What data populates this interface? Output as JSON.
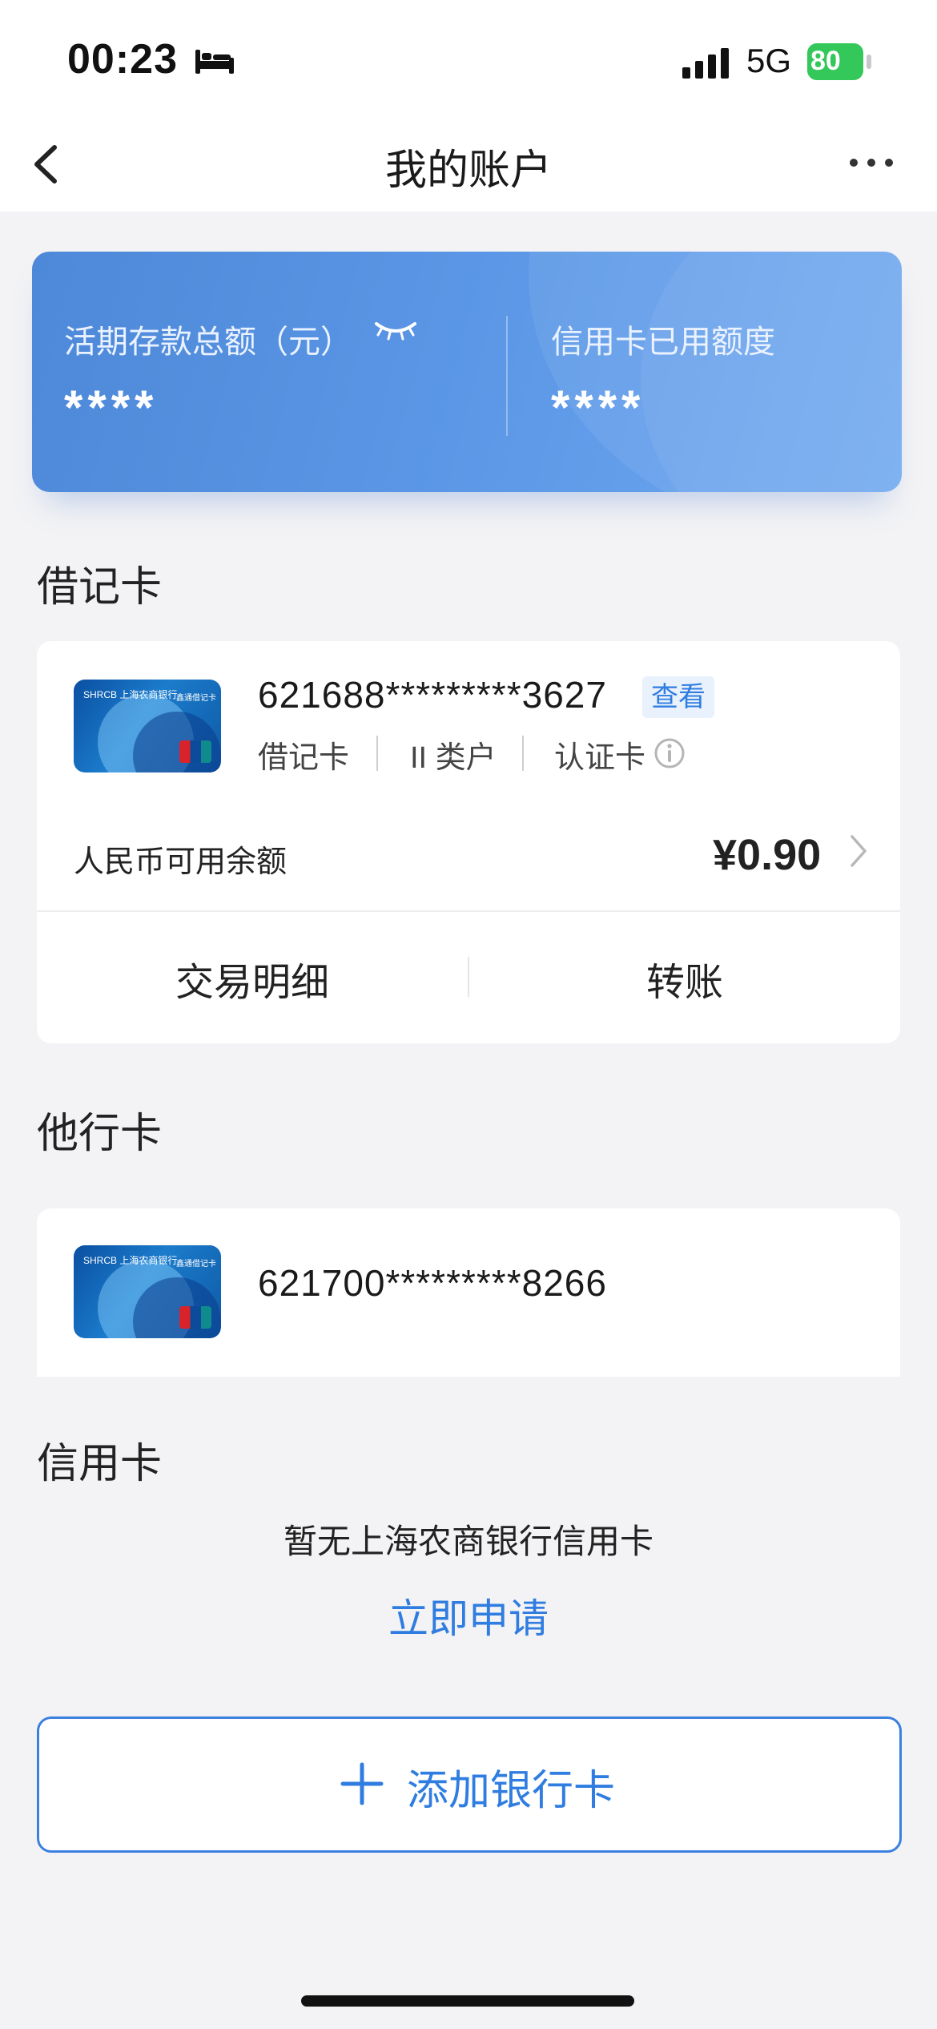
{
  "status_bar": {
    "time": "00:23",
    "network": "5G",
    "battery": "80"
  },
  "nav": {
    "title": "我的账户"
  },
  "summary": {
    "savings_label": "活期存款总额（元）",
    "savings_value": "****",
    "credit_label": "信用卡已用额度",
    "credit_value": "****"
  },
  "debit_section": {
    "title": "借记卡",
    "card": {
      "brand": "SHRCB 上海农商银行",
      "card_type_text": "鑫通借记卡",
      "number": "621688*********3627",
      "view_label": "查看",
      "tags": [
        "借记卡",
        "II 类户",
        "认证卡"
      ],
      "balance_label": "人民币可用余额",
      "balance_value": "¥0.90",
      "actions": [
        "交易明细",
        "转账"
      ]
    }
  },
  "other_section": {
    "title": "他行卡",
    "card": {
      "brand": "SHRCB 上海农商银行",
      "card_type_text": "鑫通借记卡",
      "number": "621700*********8266"
    }
  },
  "credit_section": {
    "title": "信用卡",
    "empty_text": "暂无上海农商银行信用卡",
    "apply_label": "立即申请"
  },
  "add_card": {
    "label": "添加银行卡"
  },
  "colors": {
    "accent": "#2f7de0",
    "summary_start": "#4e88d8",
    "summary_end": "#6ea8f0",
    "battery": "#34c759"
  }
}
